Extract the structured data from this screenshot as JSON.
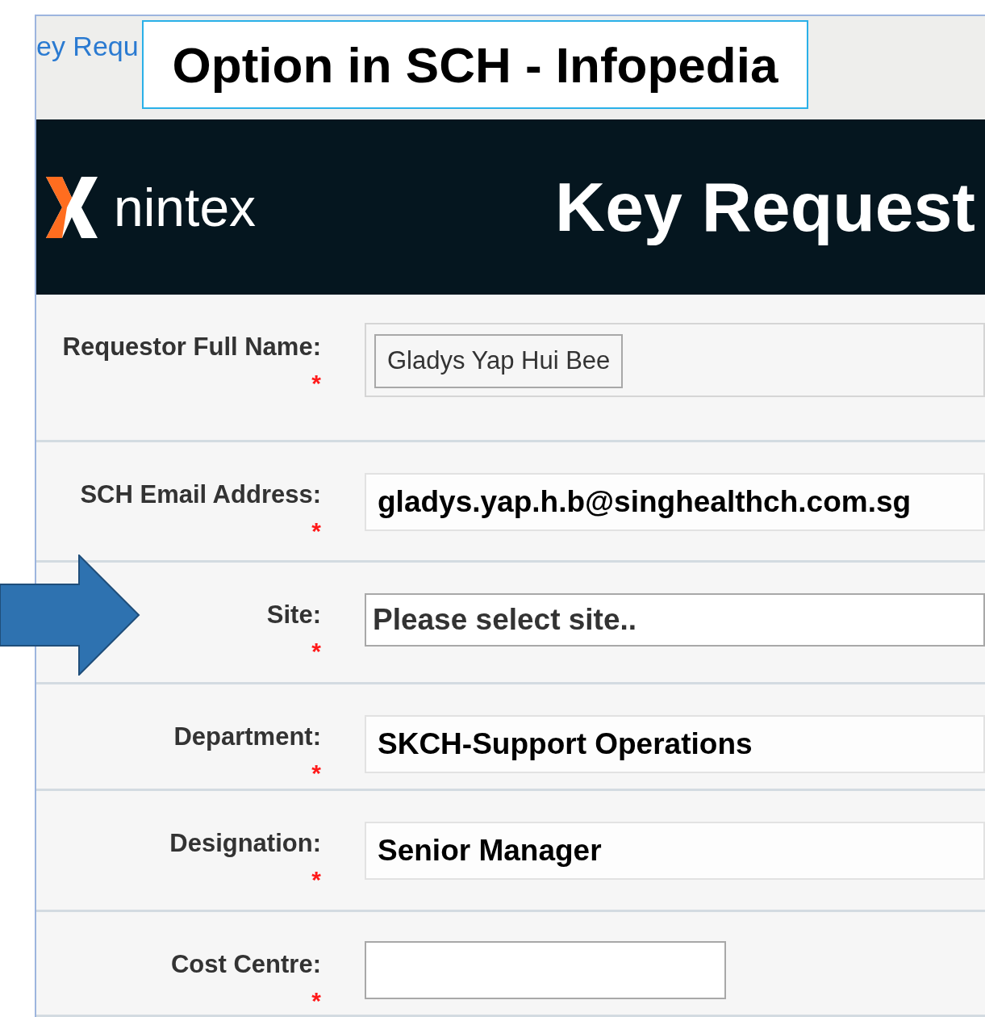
{
  "breadcrumb": "ey Requ",
  "callout": "Option in SCH - Infopedia",
  "header": {
    "logo_text": "nintex",
    "title": "Key Request"
  },
  "fields": [
    {
      "label": "Requestor Full Name:",
      "required_mark": "*",
      "kind": "readonly",
      "value": "Gladys Yap Hui Bee"
    },
    {
      "label": "SCH Email Address:",
      "required_mark": "*",
      "kind": "text",
      "value": "gladys.yap.h.b@singhealthch.com.sg"
    },
    {
      "label": "Site:",
      "required_mark": "*",
      "kind": "select",
      "value": "Please select site.."
    },
    {
      "label": "Department:",
      "required_mark": "*",
      "kind": "text",
      "value": "SKCH-Support Operations"
    },
    {
      "label": "Designation:",
      "required_mark": "*",
      "kind": "text",
      "value": "Senior Manager"
    },
    {
      "label": "Cost Centre:",
      "required_mark": "*",
      "kind": "empty"
    }
  ]
}
